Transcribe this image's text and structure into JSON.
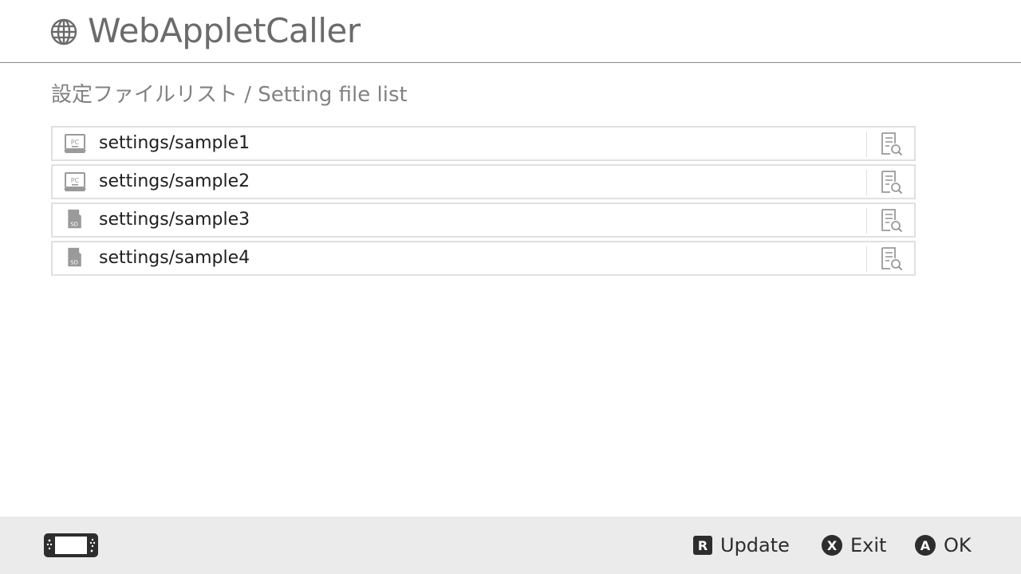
{
  "app": {
    "title": "WebAppletCaller",
    "icon": "globe-icon"
  },
  "section": {
    "title": "設定ファイルリスト / Setting file list"
  },
  "files": [
    {
      "name": "settings/sample1",
      "source": "PC",
      "source_icon": "pc-icon"
    },
    {
      "name": "settings/sample2",
      "source": "PC",
      "source_icon": "pc-icon"
    },
    {
      "name": "settings/sample3",
      "source": "SD",
      "source_icon": "sd-card-icon"
    },
    {
      "name": "settings/sample4",
      "source": "SD",
      "source_icon": "sd-card-icon"
    }
  ],
  "footer": {
    "console_icon": "handheld-console-icon",
    "hints": [
      {
        "button": "R",
        "label": "Update"
      },
      {
        "button": "X",
        "label": "Exit"
      },
      {
        "button": "A",
        "label": "OK"
      }
    ]
  },
  "colors": {
    "title": "#6b6b6b",
    "footer_bg": "#ebebeb",
    "row_border": "#e0e0e0",
    "icon_gray": "#9a9a9a",
    "badge": "#2d2d2d"
  }
}
